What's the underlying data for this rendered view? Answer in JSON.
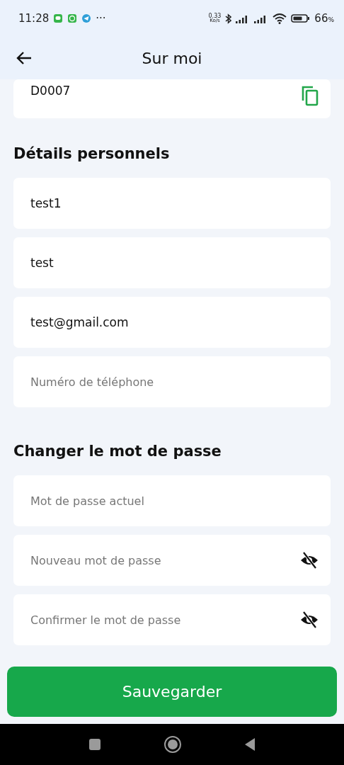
{
  "status_bar": {
    "time": "11:28",
    "more": "···",
    "speed": "0.33",
    "speed_unit": "Ko/s",
    "battery": "66",
    "battery_unit": "%"
  },
  "header": {
    "title": "Sur moi"
  },
  "id_field": {
    "value": "D0007"
  },
  "sections": [
    {
      "title": "Détails personnels",
      "fields": [
        {
          "kind": "text",
          "value": "test1"
        },
        {
          "kind": "text",
          "value": "test"
        },
        {
          "kind": "text",
          "value": "test@gmail.com"
        },
        {
          "kind": "text",
          "placeholder": "Numéro de téléphone"
        }
      ]
    },
    {
      "title": "Changer le mot de passe",
      "fields": [
        {
          "kind": "password",
          "placeholder": "Mot de passe actuel"
        },
        {
          "kind": "revealable",
          "placeholder": "Nouveau mot de passe"
        },
        {
          "kind": "revealable",
          "placeholder": "Confirmer le mot de passe"
        }
      ]
    }
  ],
  "save_button": {
    "label": "Sauvegarder"
  }
}
